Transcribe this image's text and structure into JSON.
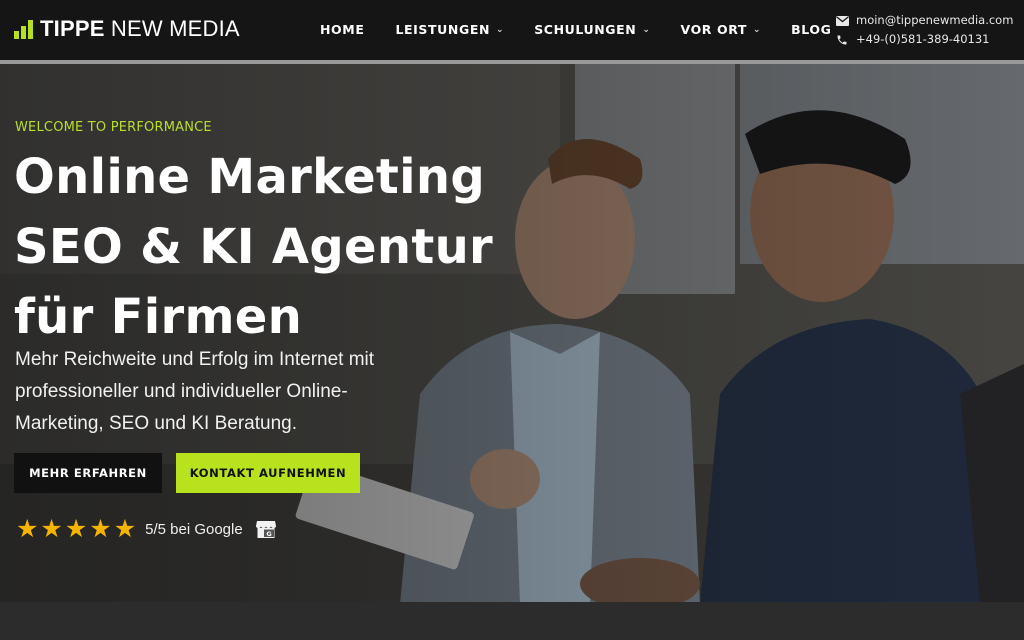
{
  "brand": {
    "name_bold": "TIPPE",
    "name_light": "NEW MEDIA",
    "accent_color": "#b7e21d"
  },
  "nav": {
    "items": [
      {
        "label": "HOME",
        "has_dropdown": false
      },
      {
        "label": "LEISTUNGEN",
        "has_dropdown": true
      },
      {
        "label": "SCHULUNGEN",
        "has_dropdown": true
      },
      {
        "label": "VOR ORT",
        "has_dropdown": true
      },
      {
        "label": "BLOG",
        "has_dropdown": false
      }
    ]
  },
  "contact": {
    "email": "moin@tippenewmedia.com",
    "email_icon": "mail-icon",
    "phone": "+49-(0)581-389-40131",
    "phone_icon": "phone-icon"
  },
  "hero": {
    "eyebrow": "WELCOME TO PERFORMANCE",
    "headline_line1": "Online Marketing",
    "headline_line2": "SEO & KI Agentur",
    "headline_line3": "für Firmen",
    "subline": "Mehr Reichweite und Erfolg im Internet mit professioneller und individueller Online-Marketing, SEO und KI Beratung.",
    "primary_button": "MEHR ERFAHREN",
    "secondary_button": "KONTAKT AUFNEHMEN"
  },
  "rating": {
    "stars": 5,
    "text": "5/5 bei Google",
    "star_color": "#f4b400",
    "badge_icon": "google-my-business-icon"
  }
}
